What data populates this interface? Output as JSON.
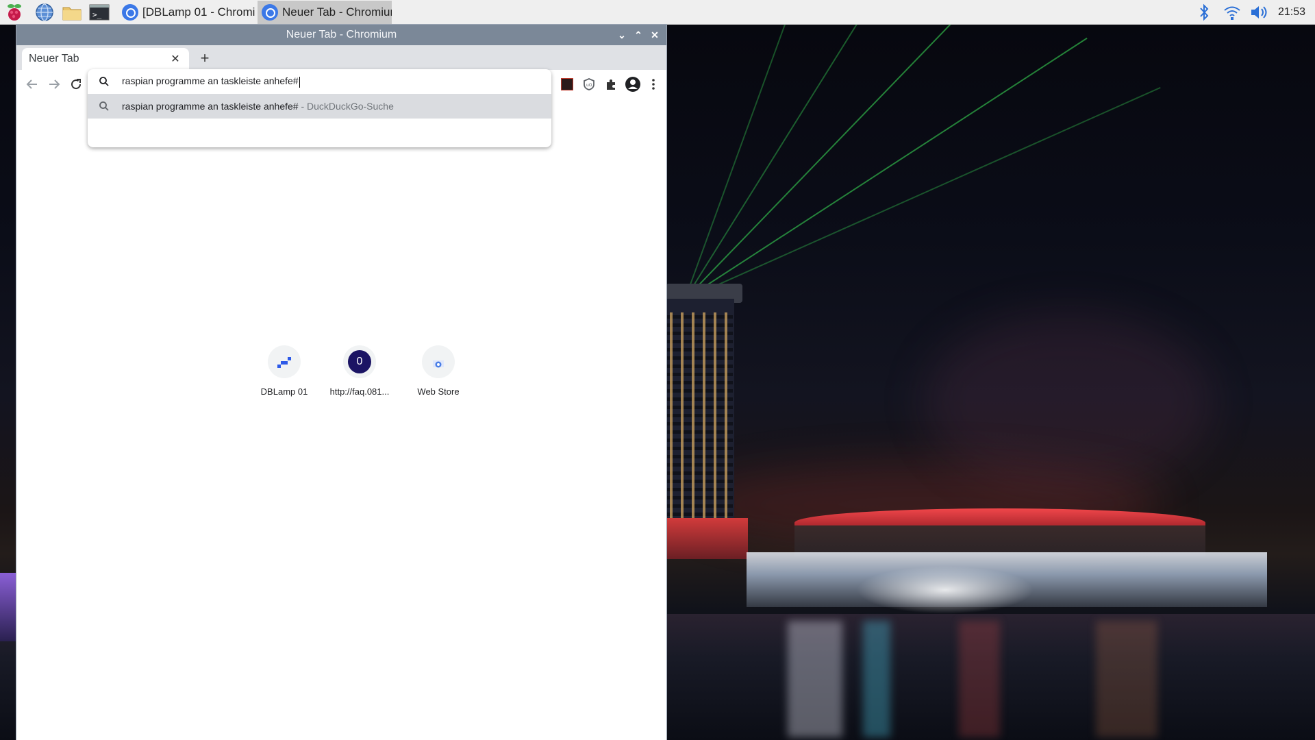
{
  "taskbar": {
    "launchers": [
      {
        "name": "raspberry-menu-icon"
      },
      {
        "name": "globe-browser-icon"
      },
      {
        "name": "folder-icon"
      },
      {
        "name": "terminal-icon"
      }
    ],
    "tasks": [
      {
        "label": "[DBLamp 01 - Chromi...",
        "active": false
      },
      {
        "label": "Neuer Tab - Chromium",
        "active": true
      }
    ],
    "tray": {
      "bluetooth": "bluetooth-icon",
      "wifi": "wifi-icon",
      "volume": "volume-icon",
      "clock": "21:53"
    }
  },
  "window": {
    "title": "Neuer Tab - Chromium",
    "controls": {
      "minimize": "⌄",
      "maximize": "⌃",
      "close": "✕"
    }
  },
  "tabs": [
    {
      "title": "Neuer Tab",
      "close": "✕"
    }
  ],
  "new_tab_button": "+",
  "omnibox": {
    "value": "raspian programme an taskleiste anhefe#",
    "suggestion_query": "raspian programme an taskleiste anhefe#",
    "suggestion_suffix": " - DuckDuckGo-Suche"
  },
  "shortcuts": [
    {
      "label": "DBLamp 01",
      "icon": "dblamp-favicon",
      "glyph": ""
    },
    {
      "label": "http://faq.081...",
      "icon": "faq-favicon",
      "glyph": "0"
    },
    {
      "label": "Web Store",
      "icon": "web-store-icon",
      "glyph": ""
    }
  ],
  "colors": {
    "titlebar": "#7b8898",
    "taskbar": "#efefef",
    "accent": "#3b78e7",
    "suggestion_highlight": "#dadce0"
  }
}
